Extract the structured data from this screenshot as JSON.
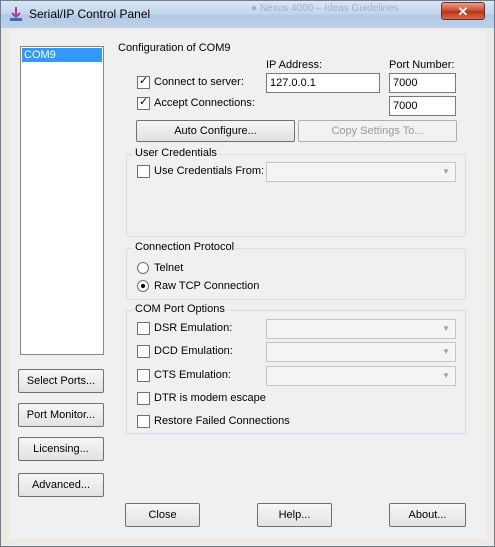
{
  "window": {
    "title": "Serial/IP Control Panel",
    "close_glyph": "✕",
    "background_title": "● Nexus 4000 – Ideas Guidelines"
  },
  "ports": {
    "items": [
      "COM9"
    ],
    "selected_index": 0
  },
  "side_buttons": {
    "select_ports": "Select Ports...",
    "port_monitor": "Port Monitor...",
    "licensing": "Licensing...",
    "advanced": "Advanced..."
  },
  "config": {
    "group_title": "Configuration of COM9",
    "ip_address_header": "IP Address:",
    "port_number_header": "Port Number:",
    "connect_to_server": {
      "label": "Connect to server:",
      "checked": true
    },
    "accept_connections": {
      "label": "Accept Connections:",
      "checked": true
    },
    "ip_address_value": "127.0.0.1",
    "connect_port_value": "7000",
    "accept_port_value": "7000",
    "auto_configure": "Auto Configure...",
    "copy_settings": "Copy Settings To..."
  },
  "credentials": {
    "group_title": "User Credentials",
    "use_credentials_from": {
      "label": "Use Credentials From:",
      "checked": false
    },
    "selected_value": ""
  },
  "protocol": {
    "group_title": "Connection Protocol",
    "options": [
      "Telnet",
      "Raw TCP Connection"
    ],
    "selected": "Raw TCP Connection"
  },
  "com_options": {
    "group_title": "COM Port Options",
    "dsr_emulation": {
      "label": "DSR Emulation:",
      "checked": false
    },
    "dcd_emulation": {
      "label": "DCD Emulation:",
      "checked": false
    },
    "cts_emulation": {
      "label": "CTS Emulation:",
      "checked": false
    },
    "dtr_modem_escape": {
      "label": "DTR is modem escape",
      "checked": false
    },
    "restore_failed": {
      "label": "Restore Failed Connections",
      "checked": false
    }
  },
  "bottom_buttons": {
    "close": "Close",
    "help": "Help...",
    "about": "About..."
  },
  "icons": {
    "app_icon": "serial-ip-arrow-icon",
    "checkmark": "✓",
    "dropdown": "▼"
  },
  "colors": {
    "selection": "#3399ff",
    "close_button": "#c8482f",
    "window_bg": "#f0f0f0"
  }
}
